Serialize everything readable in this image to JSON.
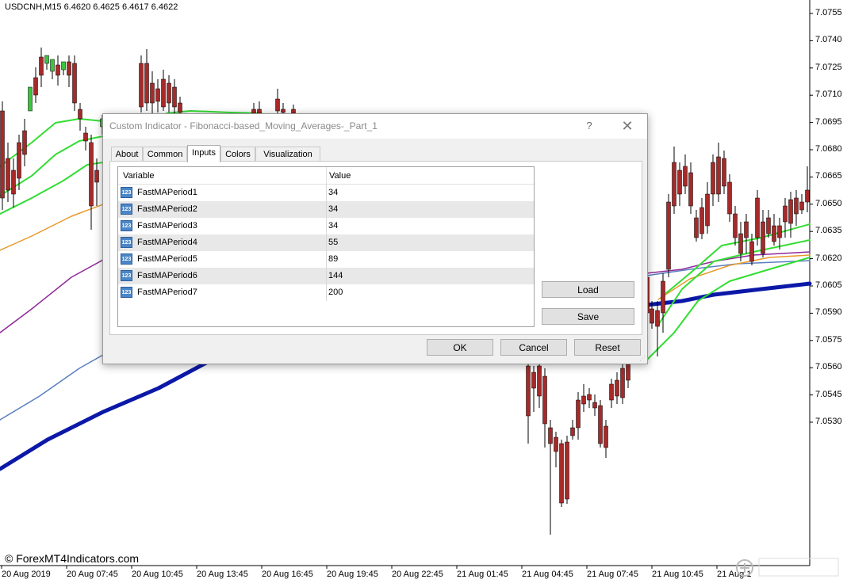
{
  "chart": {
    "symbol_info": "USDCNH,M15  6.4620 6.4625 6.4617 6.4622",
    "watermark": "© ForexMT4Indicators.com",
    "price_labels": [
      "7.0755",
      "7.0740",
      "7.0725",
      "7.0710",
      "7.0695",
      "7.0680",
      "7.0665",
      "7.0650",
      "7.0635",
      "7.0620",
      "7.0605",
      "7.0590",
      "7.0575",
      "7.0560",
      "7.0545",
      "7.0530"
    ],
    "time_labels": [
      "20 Aug 2019",
      "20 Aug 07:45",
      "20 Aug 10:45",
      "20 Aug 13:45",
      "20 Aug 16:45",
      "20 Aug 19:45",
      "20 Aug 22:45",
      "21 Aug 01:45",
      "21 Aug 04:45",
      "21 Aug 07:45",
      "21 Aug 10:45",
      "21 Aug 1"
    ],
    "colors": {
      "bull": "#3cc43c",
      "bear": "#a52a2a",
      "ma_green": "#33dd33",
      "ma_orange": "#e89a2c",
      "ma_purple": "#8e2a9a",
      "ma_steel": "#5a7fc0",
      "ma_navy": "#0b18a8"
    }
  },
  "dialog": {
    "title": "Custom Indicator - Fibonacci-based_Moving_Averages-_Part_1",
    "help_label": "?",
    "close_label": "✕",
    "tabs": [
      "About",
      "Common",
      "Inputs",
      "Colors",
      "Visualization"
    ],
    "active_tab": "Inputs",
    "grid": {
      "col_variable": "Variable",
      "col_value": "Value",
      "icon_text": "123",
      "rows": [
        {
          "name": "FastMAPeriod1",
          "value": "34"
        },
        {
          "name": "FastMAPeriod2",
          "value": "34"
        },
        {
          "name": "FastMAPeriod3",
          "value": "34"
        },
        {
          "name": "FastMAPeriod4",
          "value": "55"
        },
        {
          "name": "FastMAPeriod5",
          "value": "89"
        },
        {
          "name": "FastMAPeriod6",
          "value": "144"
        },
        {
          "name": "FastMAPeriod7",
          "value": "200"
        }
      ]
    },
    "buttons": {
      "load": "Load",
      "save": "Save",
      "ok": "OK",
      "cancel": "Cancel",
      "reset": "Reset"
    }
  }
}
